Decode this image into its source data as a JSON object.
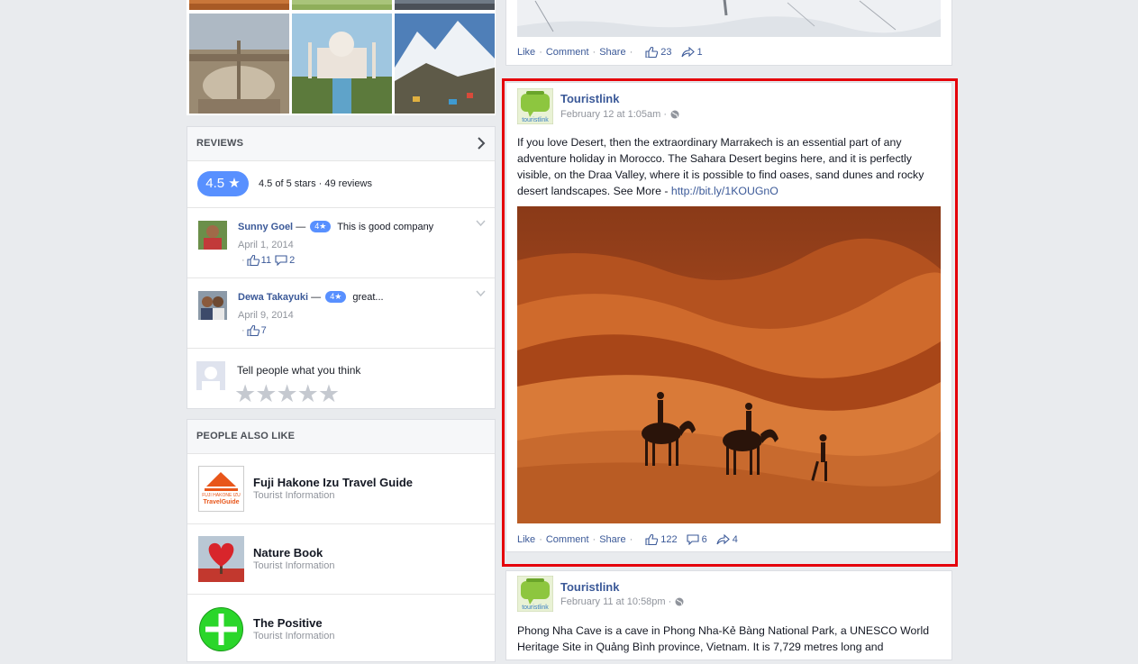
{
  "reviews": {
    "title": "REVIEWS",
    "score": "4.5 ★",
    "summary": "4.5 of 5 stars · 49 reviews",
    "items": [
      {
        "name": "Sunny Goel",
        "rating": "4★",
        "text": "This is good company",
        "date": "April 1, 2014",
        "likes": "11",
        "comments": "2"
      },
      {
        "name": "Dewa Takayuki",
        "rating": "4★",
        "text": "great...",
        "date": "April 9, 2014",
        "likes": "7"
      }
    ],
    "write_prompt": "Tell people what you think",
    "dash": "—",
    "dot": "·"
  },
  "people_also_like": {
    "title": "PEOPLE ALSO LIKE",
    "items": [
      {
        "name": "Fuji Hakone Izu Travel Guide",
        "category": "Tourist Information",
        "logo_text_1": "FUJI HAKONE IZU",
        "logo_text_2": "TravelGuide"
      },
      {
        "name": "Nature Book",
        "category": "Tourist Information"
      },
      {
        "name": "The Positive",
        "category": "Tourist Information"
      }
    ]
  },
  "feed": {
    "action_like": "Like",
    "action_comment": "Comment",
    "action_share": "Share",
    "sep": "·",
    "top_post": {
      "likes": "23",
      "shares": "1"
    },
    "main_post": {
      "page": "Touristlink",
      "logo_text": "touristlink",
      "time": "February 12 at 1:05am · ",
      "text": "If you love Desert, then the extraordinary Marrakech is an essential part of any adventure holiday in Morocco. The Sahara Desert begins here, and it is perfectly visible, on the Draa Valley, where it is possible to find oases, sand dunes and rocky desert landscapes. See More - ",
      "link": "http://bit.ly/1KOUGnO",
      "likes": "122",
      "comments": "6",
      "shares": "4"
    },
    "next_post": {
      "page": "Touristlink",
      "logo_text": "touristlink",
      "time": "February 11 at 10:58pm · ",
      "text": "Phong Nha Cave is a cave in Phong Nha-Kẻ Bàng National Park, a UNESCO World Heritage Site in Quảng Bình province, Vietnam. It is 7,729 metres long and"
    }
  },
  "colors": {
    "accent": "#5890ff",
    "link": "#3b5998",
    "highlight": "#e5000b",
    "background": "#e9ebee"
  }
}
